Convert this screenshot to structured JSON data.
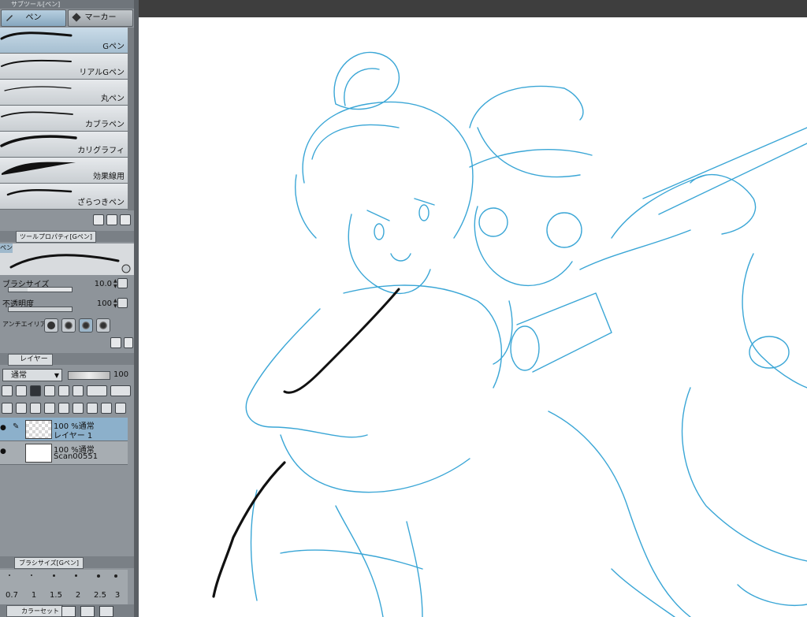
{
  "tool_palette": {
    "header_title": "サブツール[ペン]",
    "tabs": [
      {
        "label": "ペン",
        "active": true
      },
      {
        "label": "マーカー",
        "active": false
      }
    ],
    "brushes": [
      {
        "label": "Gペン",
        "selected": true
      },
      {
        "label": "リアルGペン",
        "selected": false
      },
      {
        "label": "丸ペン",
        "selected": false
      },
      {
        "label": "カブラペン",
        "selected": false
      },
      {
        "label": "カリグラフィ",
        "selected": false
      },
      {
        "label": "効果線用",
        "selected": false
      },
      {
        "label": "ざらつきペン",
        "selected": false
      }
    ]
  },
  "tool_property": {
    "tab_label": "ツールプロパティ[Gペン]",
    "preview_tag": "ペン",
    "brush_size": {
      "label": "ブラシサイズ",
      "value": "10.0"
    },
    "opacity": {
      "label": "不透明度",
      "value": "100"
    },
    "antialias_label": "アンチエイリアス"
  },
  "layer_panel": {
    "tab_label": "レイヤー",
    "blend_mode": "通常",
    "opacity": "100",
    "layers": [
      {
        "line1": "100 %通常",
        "line2": "レイヤー 1",
        "selected": true,
        "thumb": "transparent"
      },
      {
        "line1": "100 %通常",
        "line2": "Scan00551",
        "selected": false,
        "thumb": "scan"
      }
    ]
  },
  "brush_size_palette": {
    "tab_label": "ブラシサイズ[Gペン]",
    "sizes": [
      "0.7",
      "1",
      "1.5",
      "2",
      "2.5",
      "3"
    ]
  },
  "color_set": {
    "tab_label": "カラーセット"
  },
  "colors": {
    "sketch_line": "#3aa6d6",
    "ink_line": "#111111",
    "panel_bg": "#8e949a",
    "selection": "#8cb0cb"
  }
}
